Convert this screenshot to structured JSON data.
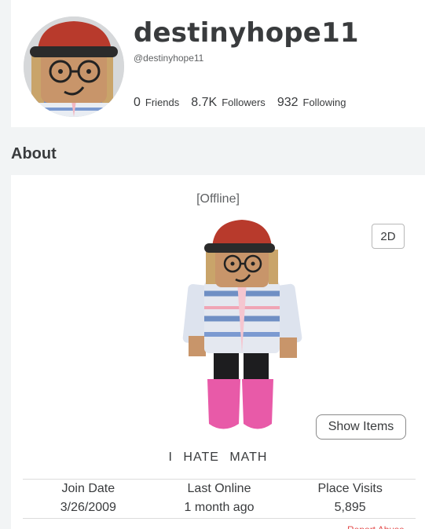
{
  "profile": {
    "display_name": "destinyhope11",
    "handle": "@destinyhope11",
    "stats": [
      {
        "value": "0",
        "label": "Friends"
      },
      {
        "value": "8.7K",
        "label": "Followers"
      },
      {
        "value": "932",
        "label": "Following"
      }
    ]
  },
  "about": {
    "title": "About",
    "status": "[Offline]",
    "view_toggle": "2D",
    "show_items": "Show Items",
    "bio": "I HATE MATH",
    "info": [
      {
        "label": "Join Date",
        "value": "3/26/2009"
      },
      {
        "label": "Last Online",
        "value": "1 month ago"
      },
      {
        "label": "Place Visits",
        "value": "5,895"
      }
    ],
    "report": "Report Abuse"
  }
}
